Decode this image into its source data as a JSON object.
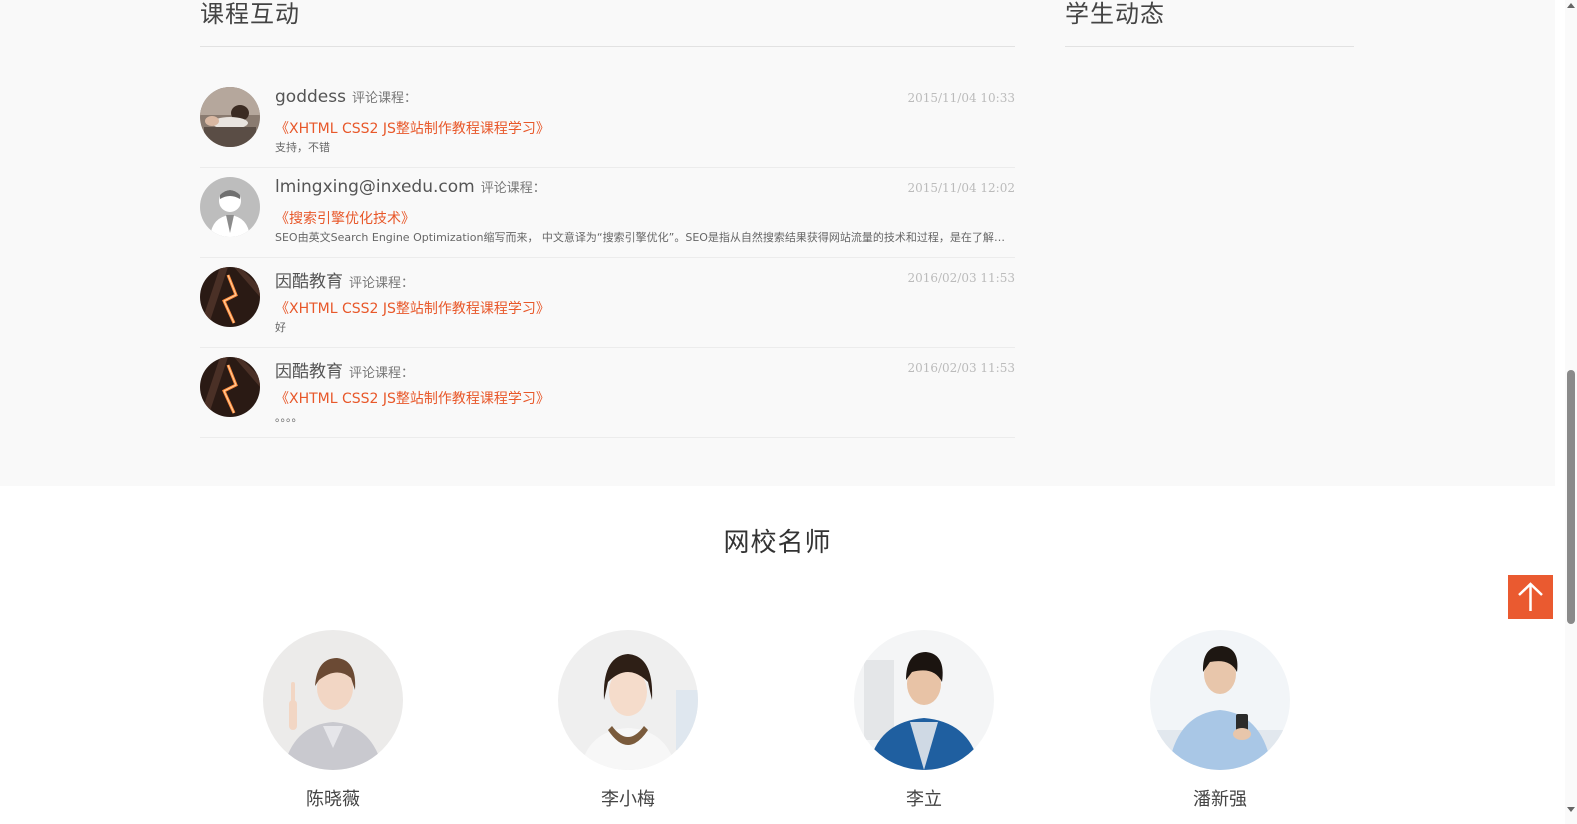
{
  "course_interaction": {
    "title": "课程互动",
    "comments": [
      {
        "user": "goddess",
        "action": "评论课程：",
        "time": "2015/11/04 10:33",
        "course": "《XHTML CSS2 JS整站制作教程课程学习》",
        "text": "支持，不错",
        "avatar": "woman-lying-photo"
      },
      {
        "user": "lmingxing@inxedu.com",
        "action": "评论课程：",
        "time": "2015/11/04 12:02",
        "course": "《搜索引擎优化技术》",
        "text": "SEO由英文Search Engine Optimization缩写而来， 中文意译为“搜索引擎优化”。SEO是指从自然搜索结果获得网站流量的技术和过程，是在了解搜索引擎自然排名机制的基础上",
        "avatar": "default-user-silhouette"
      },
      {
        "user": "因酷教育",
        "action": "评论课程：",
        "time": "2016/02/03 11:53",
        "course": "《XHTML CSS2 JS整站制作教程课程学习》",
        "text": "好",
        "avatar": "light-trail-photo"
      },
      {
        "user": "因酷教育",
        "action": "评论课程：",
        "time": "2016/02/03 11:53",
        "course": "《XHTML CSS2 JS整站制作教程课程学习》",
        "text": "。。。。",
        "avatar": "light-trail-photo"
      }
    ]
  },
  "student_activity": {
    "title": "学生动态"
  },
  "teachers": {
    "title": "网校名师",
    "items": [
      {
        "name": "陈晓薇",
        "photo": "woman-pointing-photo"
      },
      {
        "name": "李小梅",
        "photo": "woman-smiling-photo"
      },
      {
        "name": "李立",
        "photo": "man-cardigan-photo"
      },
      {
        "name": "潘新强",
        "photo": "man-phone-photo"
      }
    ]
  },
  "back_to_top": {
    "icon": "arrow-up-icon"
  },
  "colors": {
    "accent": "#ea5a30",
    "link": "#e8582a",
    "band": "#f9f9f9"
  }
}
